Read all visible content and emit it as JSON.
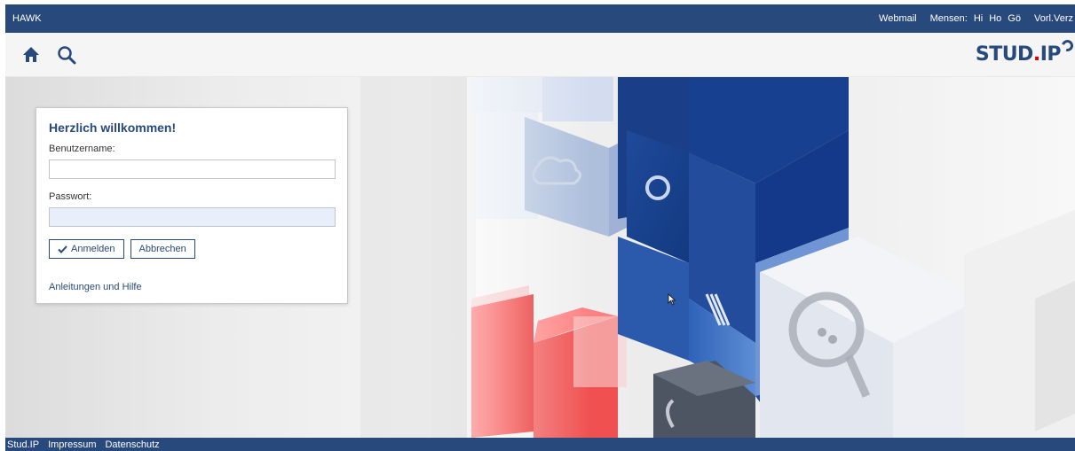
{
  "topbar": {
    "brand": "HAWK",
    "links": [
      "Webmail",
      "Mensen:",
      "Hi",
      "Ho",
      "Gö",
      "Vorl.Verz"
    ]
  },
  "header": {
    "home_icon": "home-icon",
    "search_icon": "search-icon",
    "logo_text": "STUD",
    "logo_dot": ".",
    "logo_suffix": "IP"
  },
  "login": {
    "title": "Herzlich willkommen!",
    "username_label": "Benutzername:",
    "username_value": "",
    "password_label": "Passwort:",
    "password_value": "",
    "login_button": "Anmelden",
    "cancel_button": "Abbrechen",
    "help_link": "Anleitungen und Hilfe"
  },
  "footer": {
    "links": [
      "Stud.IP",
      "Impressum",
      "Datenschutz"
    ]
  },
  "colors": {
    "brand_blue": "#28497c",
    "accent_red": "#e32b2b",
    "password_bg": "#e8effb"
  }
}
